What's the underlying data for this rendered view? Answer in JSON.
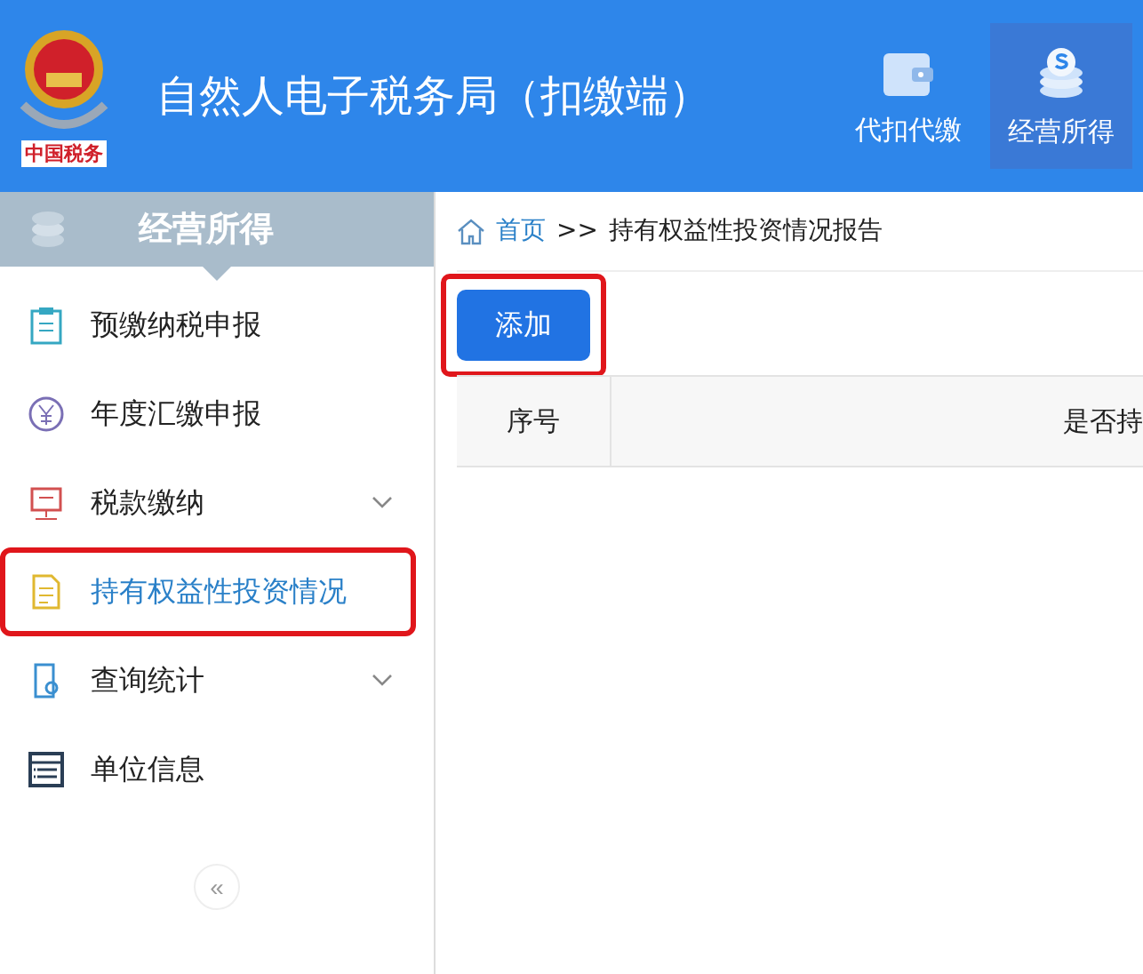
{
  "header": {
    "logo_text": "中国税务",
    "title": "自然人电子税务局（扣缴端）",
    "nav": [
      {
        "label": "代扣代缴",
        "kind": "wallet",
        "selected": false
      },
      {
        "label": "经营所得",
        "kind": "coins",
        "selected": true
      }
    ]
  },
  "sidebar": {
    "title": "经营所得",
    "items": [
      {
        "label": "预缴纳税申报",
        "kind": "clipboard",
        "selected": false,
        "expandable": false,
        "highlighted": false
      },
      {
        "label": "年度汇缴申报",
        "kind": "yen",
        "selected": false,
        "expandable": false,
        "highlighted": false
      },
      {
        "label": "税款缴纳",
        "kind": "monitor",
        "selected": false,
        "expandable": true,
        "highlighted": false
      },
      {
        "label": "持有权益性投资情况",
        "kind": "document",
        "selected": true,
        "expandable": false,
        "highlighted": true
      },
      {
        "label": "查询统计",
        "kind": "search-doc",
        "selected": false,
        "expandable": true,
        "highlighted": false
      },
      {
        "label": "单位信息",
        "kind": "list",
        "selected": false,
        "expandable": false,
        "highlighted": false
      }
    ],
    "collapse": "«"
  },
  "breadcrumb": {
    "home": "首页",
    "separator": ">>",
    "current": "持有权益性投资情况报告"
  },
  "add_button": {
    "label": "添加",
    "highlighted": true
  },
  "table": {
    "columns": [
      "序号",
      "是否持"
    ]
  }
}
